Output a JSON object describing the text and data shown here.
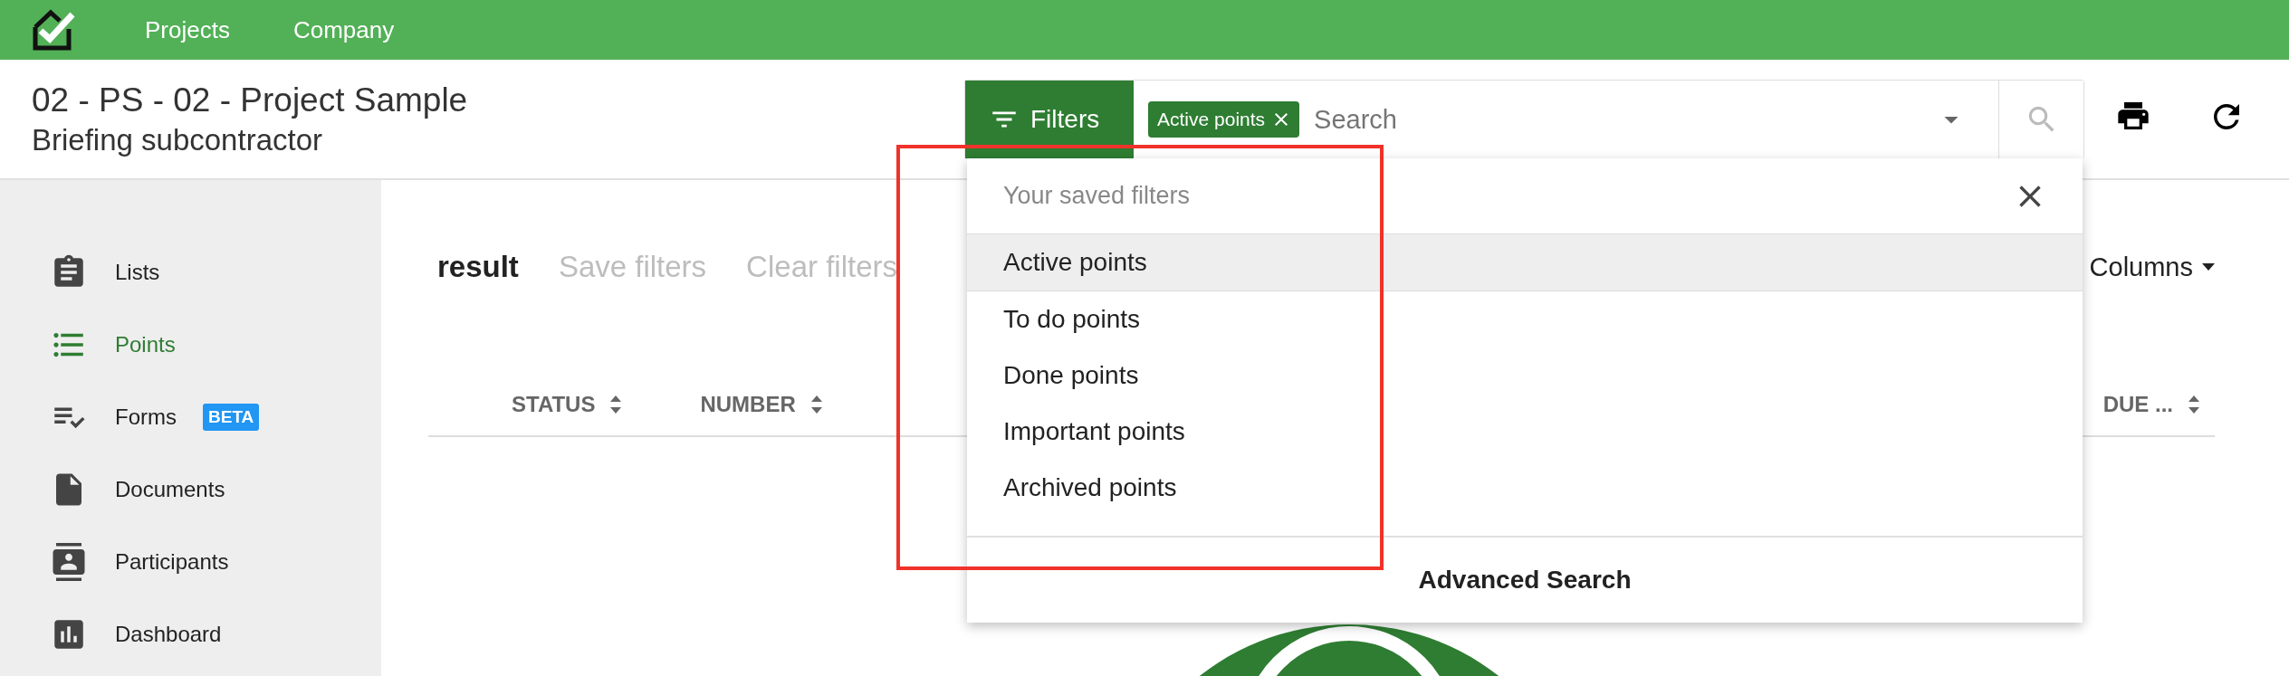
{
  "topbar": {
    "nav": [
      {
        "label": "Projects"
      },
      {
        "label": "Company"
      }
    ]
  },
  "header": {
    "title": "02 - PS - 02 - Project Sample",
    "subtitle": "Briefing subcontractor"
  },
  "search": {
    "filter_button": "Filters",
    "chips": [
      {
        "label": "Active points"
      }
    ],
    "placeholder": "Search"
  },
  "sidebar": {
    "items": [
      {
        "label": "Lists",
        "selected": false
      },
      {
        "label": "Points",
        "selected": true
      },
      {
        "label": "Forms",
        "selected": false,
        "badge": "BETA"
      },
      {
        "label": "Documents",
        "selected": false
      },
      {
        "label": "Participants",
        "selected": false
      },
      {
        "label": "Dashboard",
        "selected": false
      }
    ]
  },
  "toolbar": {
    "title": "result",
    "actions": [
      {
        "label": "Save filters",
        "disabled": true
      },
      {
        "label": "Clear filters",
        "disabled": true
      }
    ],
    "columns_button": "Columns"
  },
  "table": {
    "columns": [
      {
        "label": "STATUS"
      },
      {
        "label": "NUMBER"
      },
      {
        "label": "DUE ..."
      }
    ]
  },
  "saved_filters": {
    "heading": "Your saved filters",
    "items": [
      {
        "label": "Active points",
        "selected": true
      },
      {
        "label": "To do points",
        "selected": false
      },
      {
        "label": "Done points",
        "selected": false
      },
      {
        "label": "Important points",
        "selected": false
      },
      {
        "label": "Archived points",
        "selected": false
      }
    ],
    "footer": "Advanced Search"
  }
}
